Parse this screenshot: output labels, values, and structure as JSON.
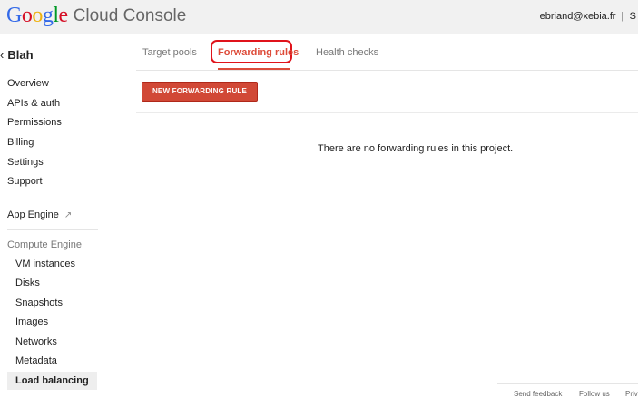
{
  "header": {
    "logo_letters": [
      {
        "char": "G",
        "color": "#3369e8"
      },
      {
        "char": "o",
        "color": "#d50f25"
      },
      {
        "char": "o",
        "color": "#eeb211"
      },
      {
        "char": "g",
        "color": "#3369e8"
      },
      {
        "char": "l",
        "color": "#009925"
      },
      {
        "char": "e",
        "color": "#d50f25"
      }
    ],
    "product": "Cloud Console",
    "user": "ebriand@xebia.fr  |  S"
  },
  "sidebar": {
    "project": "Blah",
    "project_chevron": "‹",
    "items": [
      "Overview",
      "APIs & auth",
      "Permissions",
      "Billing",
      "Settings",
      "Support"
    ],
    "app_engine": "App Engine",
    "compute_engine_label": "Compute Engine",
    "compute_items": [
      "VM instances",
      "Disks",
      "Snapshots",
      "Images",
      "Networks",
      "Metadata",
      "Load balancing"
    ],
    "active_item": "Load balancing"
  },
  "tabs": [
    {
      "label": "Target pools",
      "active": false
    },
    {
      "label": "Forwarding rules",
      "active": true
    },
    {
      "label": "Health checks",
      "active": false
    }
  ],
  "main": {
    "new_button": "NEW FORWARDING RULE",
    "empty_message": "There are no forwarding rules in this project."
  },
  "footer": {
    "links": [
      "Send feedback",
      "Follow us",
      "Priv"
    ]
  },
  "colors": {
    "accent": "#dd4b39",
    "button": "#d14836",
    "highlight_box": "#e0131b"
  }
}
